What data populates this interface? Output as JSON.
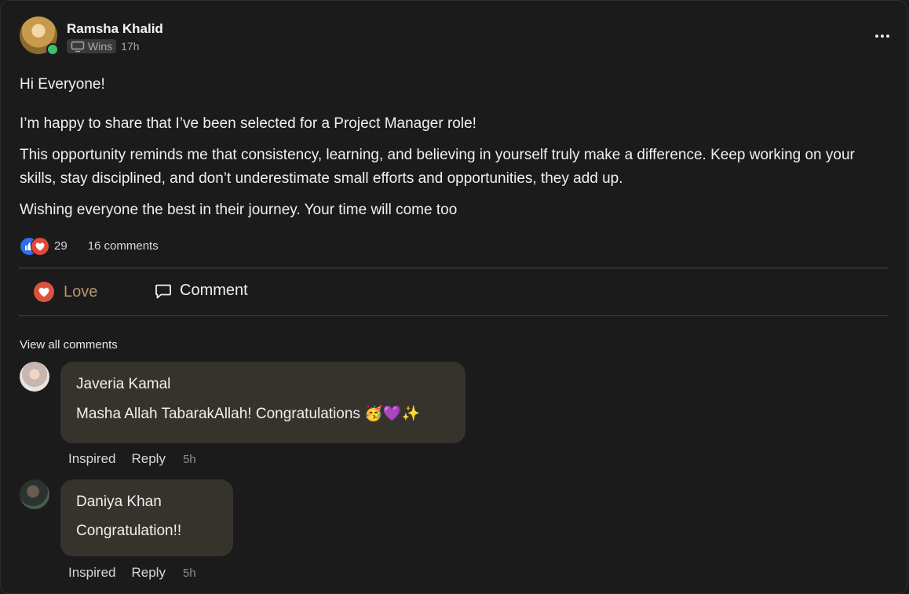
{
  "post": {
    "author": "Ramsha Khalid",
    "category": "Wins",
    "time": "17h",
    "greeting": "Hi Everyone!",
    "paragraph1": "I’m happy to share that I’ve been selected for a Project Manager role!",
    "paragraph2": "This opportunity reminds me that consistency, learning, and believing in yourself truly make a difference. Keep working on your skills, stay disciplined, and don’t underestimate small efforts and opportunities, they add up.",
    "paragraph3": "Wishing everyone the best in their journey. Your time will come too"
  },
  "stats": {
    "reactions": "29",
    "comments": "16 comments"
  },
  "actions": {
    "love_label": "Love",
    "comment_label": "Comment"
  },
  "view_all_comments": "View all comments",
  "comments": [
    {
      "author": "Javeria Kamal",
      "text": "Masha Allah TabarakAllah! Congratulations 🥳💜✨",
      "inspired": "Inspired",
      "reply": "Reply",
      "time": "5h"
    },
    {
      "author": "Daniya Khan",
      "text": "Congratulation!!",
      "inspired": "Inspired",
      "reply": "Reply",
      "time": "5h"
    }
  ],
  "colors": {
    "background": "#1b1b1b",
    "love_accent": "#b8956a",
    "comment_bubble": "#36332d",
    "online": "#3cc36a"
  },
  "icons": [
    "monitor-icon",
    "more-icon",
    "like-reaction-icon",
    "love-reaction-icon",
    "heart-icon",
    "comment-icon"
  ]
}
